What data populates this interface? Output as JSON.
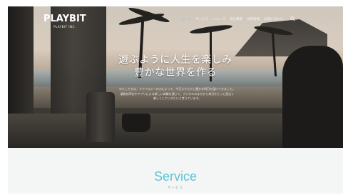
{
  "header": {
    "logo_text": "PLAYBIT",
    "logo_sub": "PLAYBIT INC.",
    "nav": [
      {
        "label": "ホーム",
        "active": true
      },
      {
        "label": "サービス",
        "active": false
      },
      {
        "label": "ニュース",
        "active": false
      },
      {
        "label": "会社概要",
        "active": false
      },
      {
        "label": "採用情報",
        "active": false
      },
      {
        "label": "お問い合わせ",
        "active": false
      }
    ],
    "search_icon": "search-icon"
  },
  "hero": {
    "headline_line1": "遊ぶように人生を楽しみ",
    "headline_line2": "豊かな世界を作る",
    "lead_line1": "わたしたちは、テクノロジーの力によって、今日よりも少し豊かな明日を届けてきました。",
    "lead_line2": "業務効率化やアプリによる新しい体験を通じて、デジタルのまちから毎日をもっと面白く",
    "lead_line3": "楽しくしていきたいと考えています。"
  },
  "service": {
    "title": "Service",
    "subtitle": "サービス"
  },
  "colors": {
    "accent": "#5cc2d9",
    "nav_active": "#7fd0e0"
  }
}
